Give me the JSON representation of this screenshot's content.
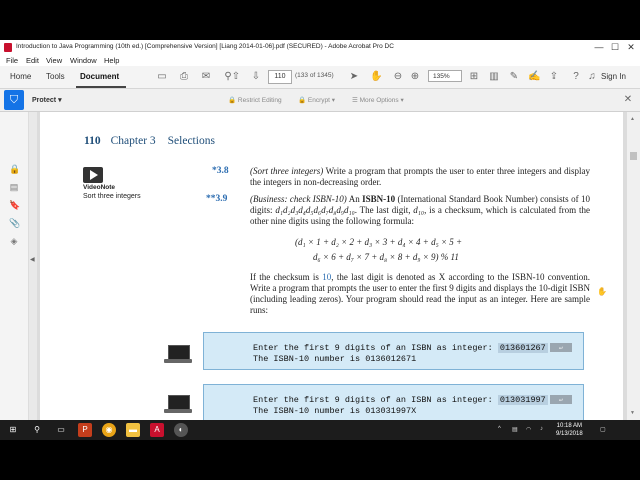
{
  "window": {
    "title": "Introduction to Java Programming (10th ed.) [Comprehensive Version] [Liang 2014-01-06].pdf (SECURED) - Adobe Acrobat Pro DC",
    "controls": [
      "—",
      "☐",
      "✕"
    ]
  },
  "menu": [
    "File",
    "Edit",
    "View",
    "Window",
    "Help"
  ],
  "toolbar": {
    "tabs": [
      "Home",
      "Tools",
      "Document"
    ],
    "active_tab": "Document",
    "page_current": "110",
    "page_count": "(133 of 1345)",
    "zoom": "135%",
    "signin": "Sign In"
  },
  "protect": {
    "label": "Protect",
    "options": [
      "Restrict Editing",
      "Encrypt",
      "More Options"
    ]
  },
  "page": {
    "page_number": "110",
    "chapter": "Chapter 3",
    "section": "Selections",
    "videonote_label": "VideoNote",
    "videonote_title": "Sort three integers",
    "ex38": {
      "num": "*3.8",
      "title": "(Sort three integers)",
      "text": " Write a program that prompts the user to enter three integers and display the integers in non-decreasing order."
    },
    "ex39": {
      "num": "**3.9",
      "title": "(Business: check ISBN-10)",
      "intro_a": " An ",
      "isbn_bold": "ISBN-10",
      "intro_b": " (International Standard Book Number) consists of 10 digits: ",
      "digits": "d₁d₂d₃d₄d₅d₆d₇d₈d₉d₁₀",
      "intro_c": ". The last digit, ",
      "d10": "d₁₀",
      "intro_d": ", is a checksum, which is calculated from the other nine digits using the following formula:",
      "formula_line1": "(d₁ × 1 + d₂ × 2 + d₃ × 3 + d₄ × 4 + d₅ × 5 +",
      "formula_line2": "d₆ × 6 + d₇ × 7 + d₈ × 8 + d₉ × 9) % 11",
      "para2_a": "If the checksum is ",
      "para2_num": "10",
      "para2_b": ", the last digit is denoted as X according to the ISBN-10 convention. Write a program that prompts the user to enter the first 9 digits and displays the 10-digit ISBN (including leading zeros). Your program should read the input as an integer. Here are sample runs:"
    },
    "run1": {
      "prompt": "Enter the first 9 digits of an ISBN as integer: ",
      "input": "013601267",
      "enter": "↵",
      "output": "The ISBN-10 number is 0136012671"
    },
    "run2": {
      "prompt": "Enter the first 9 digits of an ISBN as integer: ",
      "input": "013031997",
      "enter": "↵",
      "output": "The ISBN-10 number is 013031997X"
    }
  },
  "taskbar": {
    "time": "10:18 AM",
    "date": "9/13/2018"
  }
}
